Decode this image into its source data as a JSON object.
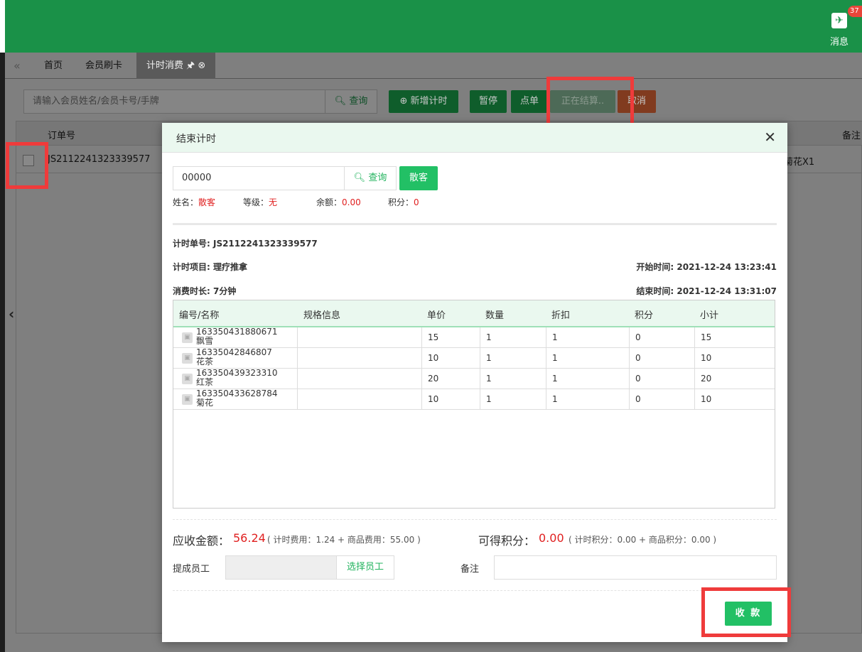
{
  "topbar": {
    "message_label": "消息",
    "message_badge": "37"
  },
  "tabs": [
    {
      "label": "首页"
    },
    {
      "label": "会员刷卡"
    },
    {
      "label": "计时消费"
    }
  ],
  "toolbar": {
    "search_placeholder": "请输入会员姓名/会员卡号/手牌",
    "query_label": "查询",
    "new_timer_label": "新增计时",
    "pause_label": "暂停",
    "order_label": "点单",
    "settling_label": "正在结算..",
    "cancel_label": "取消"
  },
  "bg_table": {
    "col_order": "订单号",
    "col_remark": "备注",
    "row_order": "JS2112241323339577",
    "row_items": "菊花X1"
  },
  "modal": {
    "title": "结束计时",
    "member_input_value": "00000",
    "query_label": "查询",
    "walkin_label": "散客",
    "info": {
      "name_label": "姓名：",
      "name_value": "散客",
      "level_label": "等级：",
      "level_value": "无",
      "balance_label": "余额：",
      "balance_value": "0.00",
      "points_label": "积分：",
      "points_value": "0"
    },
    "timer_no": "计时单号: JS2112241323339577",
    "timer_item": "计时项目: 理疗推拿",
    "start_time": "开始时间: 2021-12-24 13:23:41",
    "duration": "消费时长: 7分钟",
    "end_time": "结束时间: 2021-12-24 13:31:07",
    "table": {
      "headers": [
        "编号/名称",
        "规格信息",
        "单价",
        "数量",
        "折扣",
        "积分",
        "小计"
      ],
      "rows": [
        {
          "code": "163350431880671",
          "name": "飘雪",
          "spec": "",
          "price": "15",
          "qty": "1",
          "discount": "1",
          "points": "0",
          "subtotal": "15"
        },
        {
          "code": "16335042846807",
          "name": "花茶",
          "spec": "",
          "price": "10",
          "qty": "1",
          "discount": "1",
          "points": "0",
          "subtotal": "10"
        },
        {
          "code": "163350439323310",
          "name": "红茶",
          "spec": "",
          "price": "20",
          "qty": "1",
          "discount": "1",
          "points": "0",
          "subtotal": "20"
        },
        {
          "code": "163350433628784",
          "name": "菊花",
          "spec": "",
          "price": "10",
          "qty": "1",
          "discount": "1",
          "points": "0",
          "subtotal": "10"
        }
      ]
    },
    "receivable_label": "应收金额：",
    "receivable_value": "56.24",
    "receivable_detail": "( 计时费用：1.24 + 商品费用：55.00 )",
    "earn_points_label": "可得积分：",
    "earn_points_value": "0.00",
    "earn_points_detail": "( 计时积分：0.00 + 商品积分：0.00 )",
    "staff_label": "提成员工",
    "select_staff_label": "选择员工",
    "remark_label": "备注",
    "pay_label": "收 款"
  },
  "colors": {
    "brand_green": "#1a9148",
    "button_green": "#22c065",
    "highlight_red": "#ef3b3b",
    "amount_red": "#e02020"
  }
}
